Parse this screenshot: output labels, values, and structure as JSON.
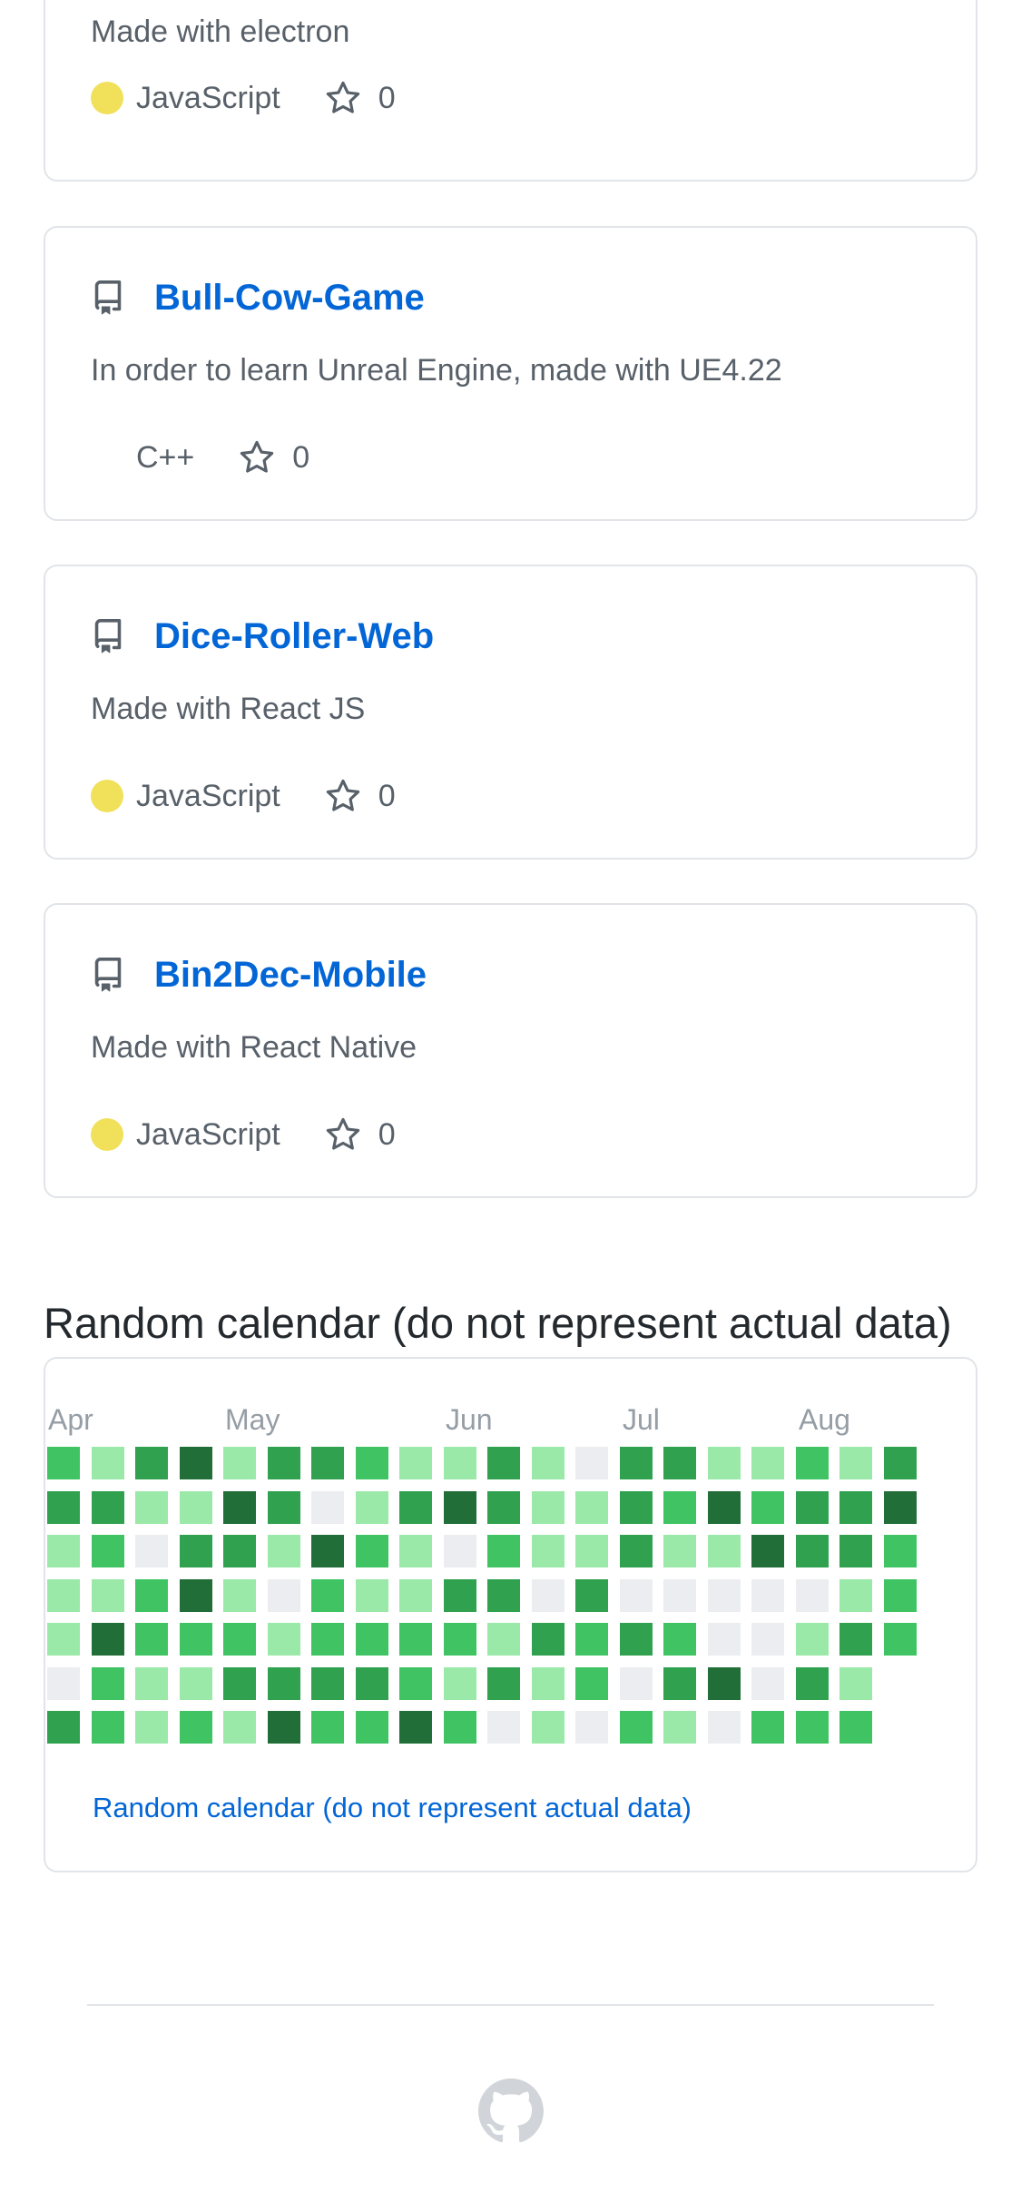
{
  "repos": [
    {
      "name": "",
      "description": "Made with electron",
      "language": "JavaScript",
      "has_language_color": true,
      "stars": "0"
    },
    {
      "name": "Bull-Cow-Game",
      "description": "In order to learn Unreal Engine, made with UE4.22",
      "language": "C++",
      "has_language_color": false,
      "stars": "0"
    },
    {
      "name": "Dice-Roller-Web",
      "description": "Made with React JS",
      "language": "JavaScript",
      "has_language_color": true,
      "stars": "0"
    },
    {
      "name": "Bin2Dec-Mobile",
      "description": "Made with React Native",
      "language": "JavaScript",
      "has_language_color": true,
      "stars": "0"
    }
  ],
  "calendar": {
    "title": "Random calendar (do not represent actual data)",
    "link_label": "Random calendar (do not represent actual data)",
    "months": [
      "Apr",
      "May",
      "Jun",
      "Jul",
      "Aug"
    ],
    "levels": [
      [
        2,
        1,
        3,
        4,
        1,
        3,
        3,
        2,
        1,
        1,
        3,
        1,
        0,
        3,
        3,
        1,
        1,
        2,
        1,
        3
      ],
      [
        3,
        3,
        1,
        1,
        4,
        3,
        0,
        1,
        3,
        4,
        3,
        1,
        1,
        3,
        2,
        4,
        2,
        3,
        3,
        4
      ],
      [
        1,
        2,
        0,
        3,
        3,
        1,
        4,
        2,
        1,
        0,
        2,
        1,
        1,
        3,
        1,
        1,
        4,
        3,
        3,
        2
      ],
      [
        1,
        1,
        2,
        4,
        1,
        0,
        2,
        1,
        1,
        3,
        3,
        0,
        3,
        0,
        0,
        0,
        0,
        0,
        1,
        2
      ],
      [
        1,
        4,
        2,
        2,
        2,
        1,
        2,
        2,
        2,
        2,
        1,
        3,
        2,
        3,
        2,
        0,
        0,
        1,
        3,
        2
      ],
      [
        0,
        2,
        1,
        1,
        3,
        3,
        3,
        3,
        2,
        1,
        3,
        1,
        2,
        0,
        3,
        4,
        0,
        3,
        1,
        -1
      ],
      [
        3,
        2,
        1,
        2,
        1,
        4,
        2,
        2,
        4,
        2,
        0,
        1,
        0,
        2,
        1,
        0,
        2,
        2,
        2,
        -1
      ]
    ],
    "level_colors": [
      "#ebedf0",
      "#9be9a8",
      "#40c463",
      "#30a14e",
      "#216e39"
    ]
  },
  "footer": {
    "logo": "github-logo-icon"
  },
  "colors": {
    "link": "#0366d6",
    "javascript": "#f1e05a"
  }
}
